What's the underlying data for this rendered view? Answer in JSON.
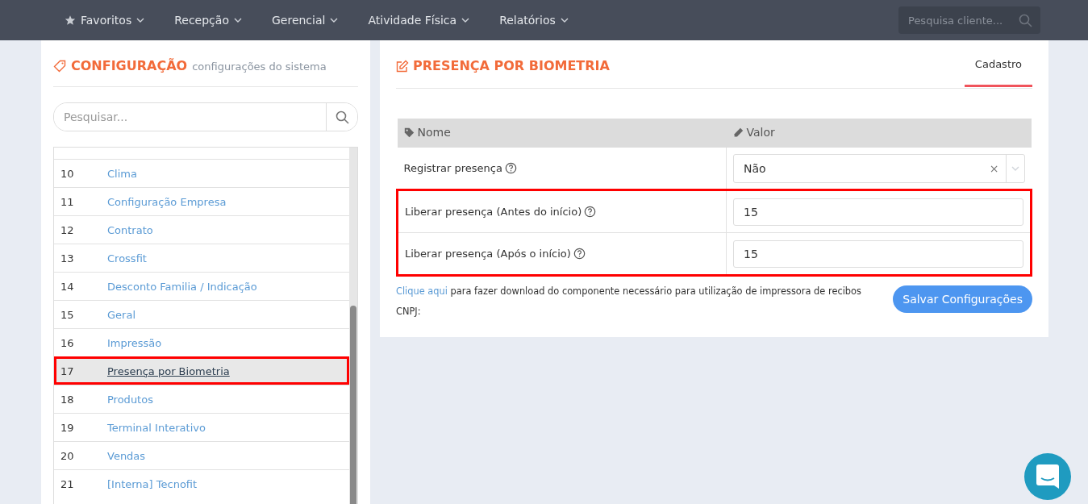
{
  "navbar": {
    "menu": [
      {
        "label": "Favoritos"
      },
      {
        "label": "Recepção"
      },
      {
        "label": "Gerencial"
      },
      {
        "label": "Atividade Física"
      },
      {
        "label": "Relatórios"
      }
    ],
    "search": {
      "placeholder": "Pesquisa cliente..."
    }
  },
  "sidebar": {
    "title": "CONFIGURAÇÃO",
    "subtitle": "configurações do sistema",
    "search": {
      "placeholder": "Pesquisar..."
    },
    "items": [
      {
        "number": "10",
        "label": "Clima",
        "selected": false,
        "highlighted": false
      },
      {
        "number": "11",
        "label": "Configuração Empresa",
        "selected": false,
        "highlighted": false
      },
      {
        "number": "12",
        "label": "Contrato",
        "selected": false,
        "highlighted": false
      },
      {
        "number": "13",
        "label": "Crossfit",
        "selected": false,
        "highlighted": false
      },
      {
        "number": "14",
        "label": "Desconto Familia / Indicação",
        "selected": false,
        "highlighted": false
      },
      {
        "number": "15",
        "label": "Geral",
        "selected": false,
        "highlighted": false
      },
      {
        "number": "16",
        "label": "Impressão",
        "selected": false,
        "highlighted": false
      },
      {
        "number": "17",
        "label": "Presença por Biometria",
        "selected": true,
        "highlighted": true
      },
      {
        "number": "18",
        "label": "Produtos",
        "selected": false,
        "highlighted": false
      },
      {
        "number": "19",
        "label": "Terminal Interativo",
        "selected": false,
        "highlighted": false
      },
      {
        "number": "20",
        "label": "Vendas",
        "selected": false,
        "highlighted": false
      },
      {
        "number": "21",
        "label": "[Interna] Tecnofit",
        "selected": false,
        "highlighted": false
      }
    ]
  },
  "panel": {
    "title": "PRESENÇA POR BIOMETRIA",
    "tabs": [
      {
        "label": "Cadastro",
        "selected": true
      }
    ],
    "table": {
      "columns": [
        "Nome",
        "Valor"
      ],
      "rows": [
        {
          "name": "Registrar presença",
          "kind": "select",
          "value": "Não",
          "clear": "×",
          "highlighted": false
        },
        {
          "name": "Liberar presença (Antes do início)",
          "kind": "input",
          "value": "15",
          "highlighted": true
        },
        {
          "name": "Liberar presença (Após o início)",
          "kind": "input",
          "value": "15",
          "highlighted": true
        }
      ]
    },
    "download_link": "Clique aqui",
    "download_text": "para fazer download do componente necessário para utilização de impressora de recibos",
    "cnpj_label": "CNPJ:",
    "save_button": "Salvar Configurações"
  }
}
